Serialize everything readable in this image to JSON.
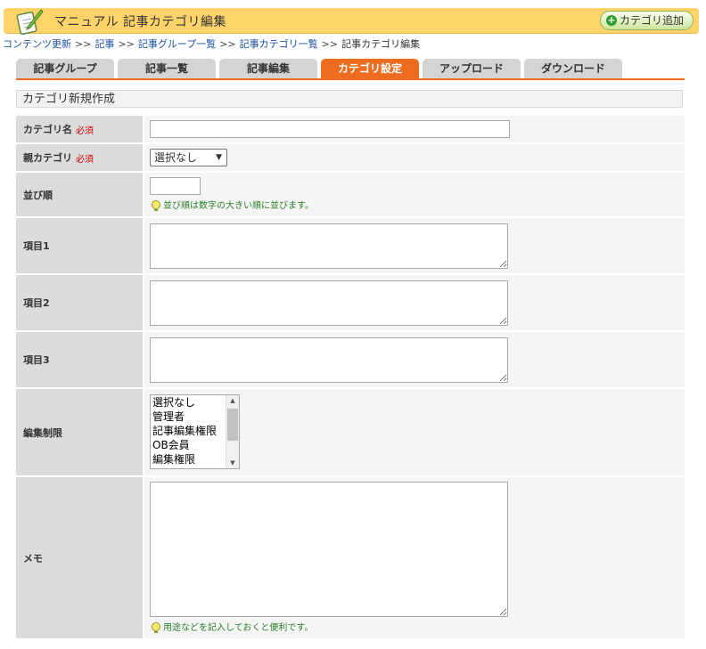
{
  "header": {
    "title": "マニュアル 記事カテゴリ編集",
    "add_button_label": "カテゴリ追加"
  },
  "breadcrumb": {
    "items": [
      "コンテンツ更新",
      "記事",
      "記事グループ一覧",
      "記事カテゴリ一覧"
    ],
    "current": "記事カテゴリ編集",
    "separator": ">>"
  },
  "tabs": [
    {
      "label": "記事グループ",
      "active": false
    },
    {
      "label": "記事一覧",
      "active": false
    },
    {
      "label": "記事編集",
      "active": false
    },
    {
      "label": "カテゴリ設定",
      "active": true
    },
    {
      "label": "アップロード",
      "active": false
    },
    {
      "label": "ダウンロード",
      "active": false
    }
  ],
  "section_title": "カテゴリ新規作成",
  "form": {
    "required_mark": "必須",
    "category_name": {
      "label": "カテゴリ名",
      "value": ""
    },
    "parent_category": {
      "label": "親カテゴリ",
      "selected": "選択なし"
    },
    "order": {
      "label": "並び順",
      "value": "",
      "hint": "並び順は数字の大きい順に並びます。"
    },
    "item1": {
      "label": "項目1"
    },
    "item2": {
      "label": "項目2"
    },
    "item3": {
      "label": "項目3"
    },
    "edit_restriction": {
      "label": "編集制限",
      "options": [
        "選択なし",
        "管理者",
        "記事編集権限",
        "OB会員",
        "編集権限"
      ]
    },
    "memo": {
      "label": "メモ",
      "hint": "用途などを記入しておくと便利です。"
    }
  },
  "colors": {
    "header_bg": "#fdd36a",
    "active_tab": "#ed6c1f",
    "link": "#1a4fa0",
    "required": "#d80000",
    "hint": "#2a7d2a"
  }
}
